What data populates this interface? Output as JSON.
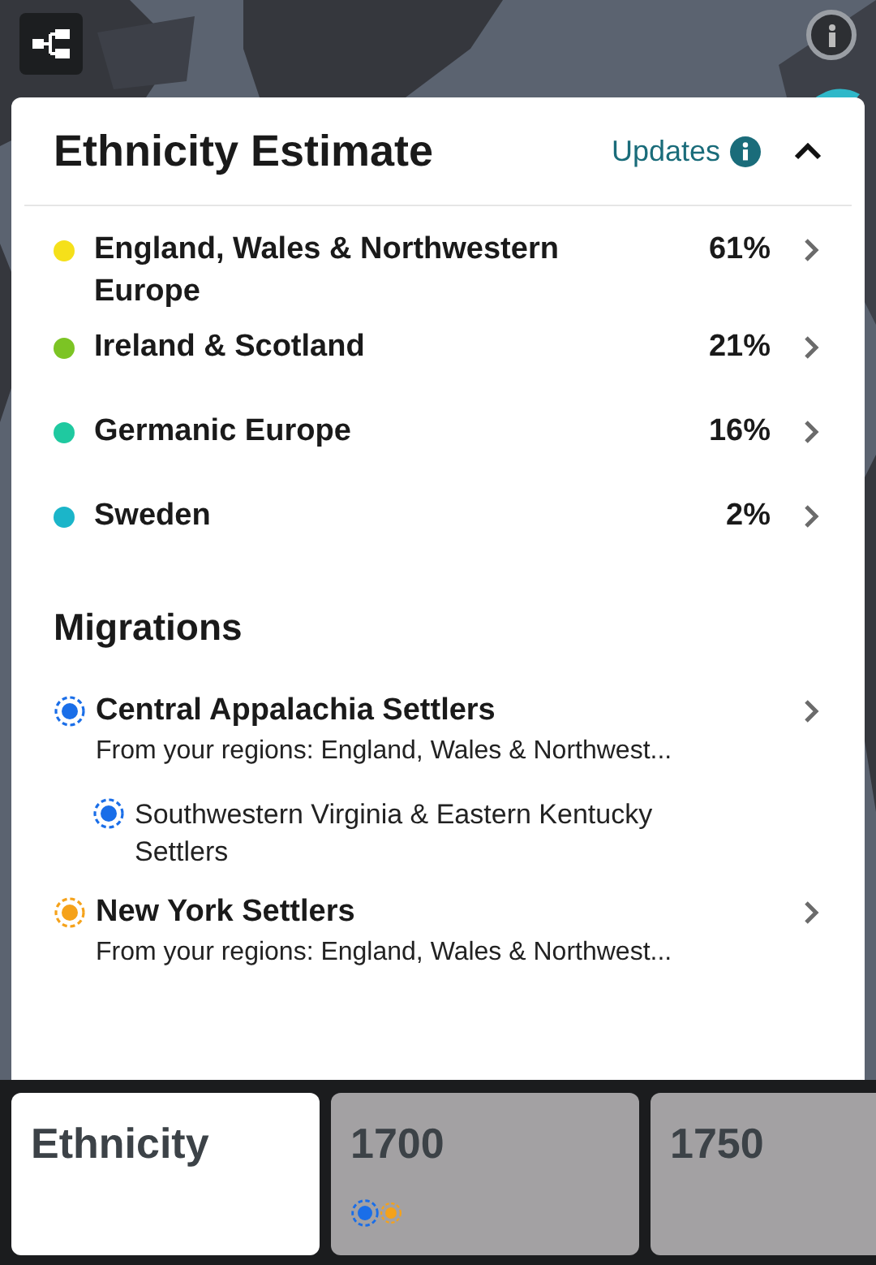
{
  "header": {
    "title": "Ethnicity Estimate",
    "updates_link": "Updates",
    "expanded": true
  },
  "regions": [
    {
      "name": "England, Wales & Northwestern Europe",
      "percent": "61%",
      "color": "#f5e01a"
    },
    {
      "name": "Ireland & Scotland",
      "percent": "21%",
      "color": "#7cc424"
    },
    {
      "name": "Germanic Europe",
      "percent": "16%",
      "color": "#1fc9a0"
    },
    {
      "name": "Sweden",
      "percent": "2%",
      "color": "#1bb5c9"
    }
  ],
  "migrations": {
    "title": "Migrations",
    "items": [
      {
        "name": "Central Appalachia Settlers",
        "subtitle": "From your regions: England, Wales & Northwest...",
        "color": "#1a6ee8",
        "children": [
          {
            "name": "Southwestern Virginia & Eastern Kentucky Settlers",
            "color": "#1a6ee8"
          }
        ]
      },
      {
        "name": "New York Settlers",
        "subtitle": "From your regions: England, Wales & Northwest...",
        "color": "#f5a21a"
      }
    ]
  },
  "tabs": [
    {
      "label": "Ethnicity",
      "selected": true
    },
    {
      "label": "1700",
      "selected": false,
      "markers": [
        {
          "color": "#1a6ee8"
        },
        {
          "color": "#f5a21a"
        }
      ]
    },
    {
      "label": "1750",
      "selected": false
    }
  ]
}
